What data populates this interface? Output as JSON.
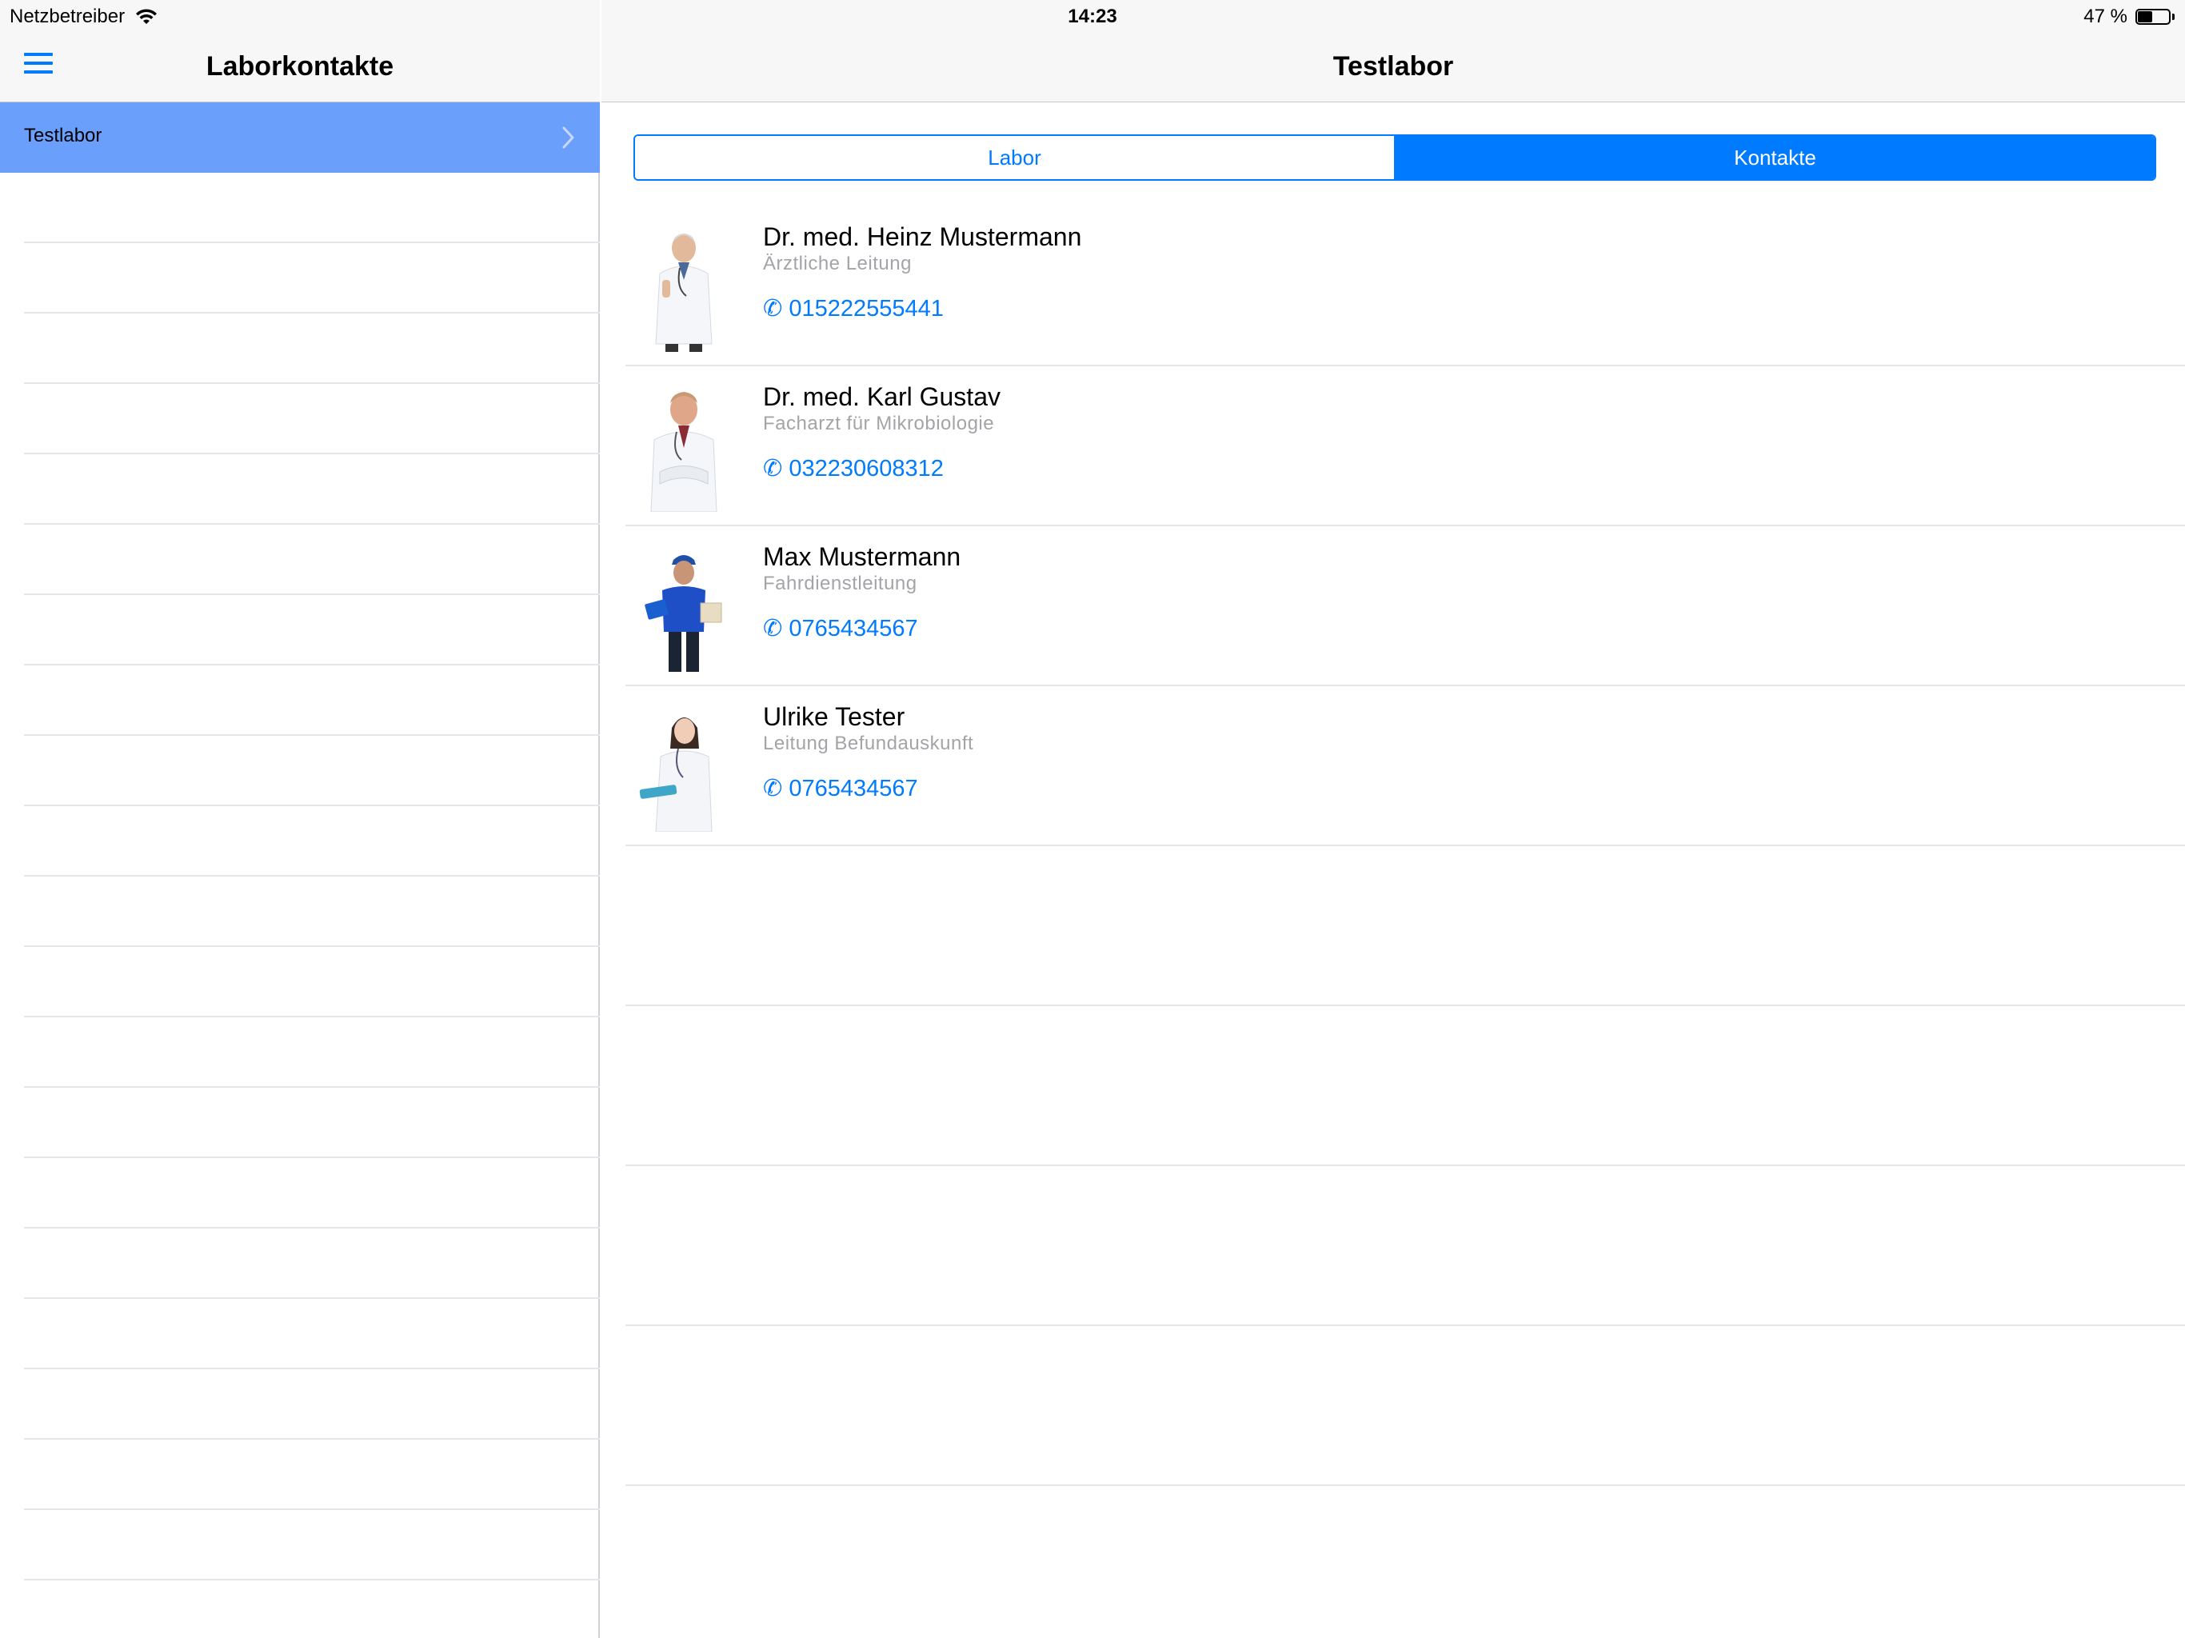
{
  "status_bar": {
    "carrier": "Netzbetreiber",
    "time": "14:23",
    "battery": "47 %",
    "battery_level": 0.47
  },
  "master": {
    "title": "Laborkontakte",
    "items": [
      {
        "label": "Testlabor",
        "selected": true
      }
    ]
  },
  "detail": {
    "title": "Testlabor",
    "segments": [
      {
        "label": "Labor",
        "active": false
      },
      {
        "label": "Kontakte",
        "active": true
      }
    ],
    "contacts": [
      {
        "name": "Dr. med. Heinz Mustermann",
        "role": "Ärztliche Leitung",
        "phone": "✆ 015222555441"
      },
      {
        "name": "Dr. med. Karl Gustav",
        "role": "Facharzt für Mikrobiologie",
        "phone": "✆ 032230608312"
      },
      {
        "name": "Max Mustermann",
        "role": "Fahrdienstleitung",
        "phone": "✆ 0765434567"
      },
      {
        "name": "Ulrike Tester",
        "role": "Leitung Befundauskunft",
        "phone": "✆ 0765434567"
      }
    ]
  },
  "colors": {
    "accent": "#007aff",
    "selected_row": "#6a9ffb",
    "secondary_text": "#a4a4a8"
  }
}
